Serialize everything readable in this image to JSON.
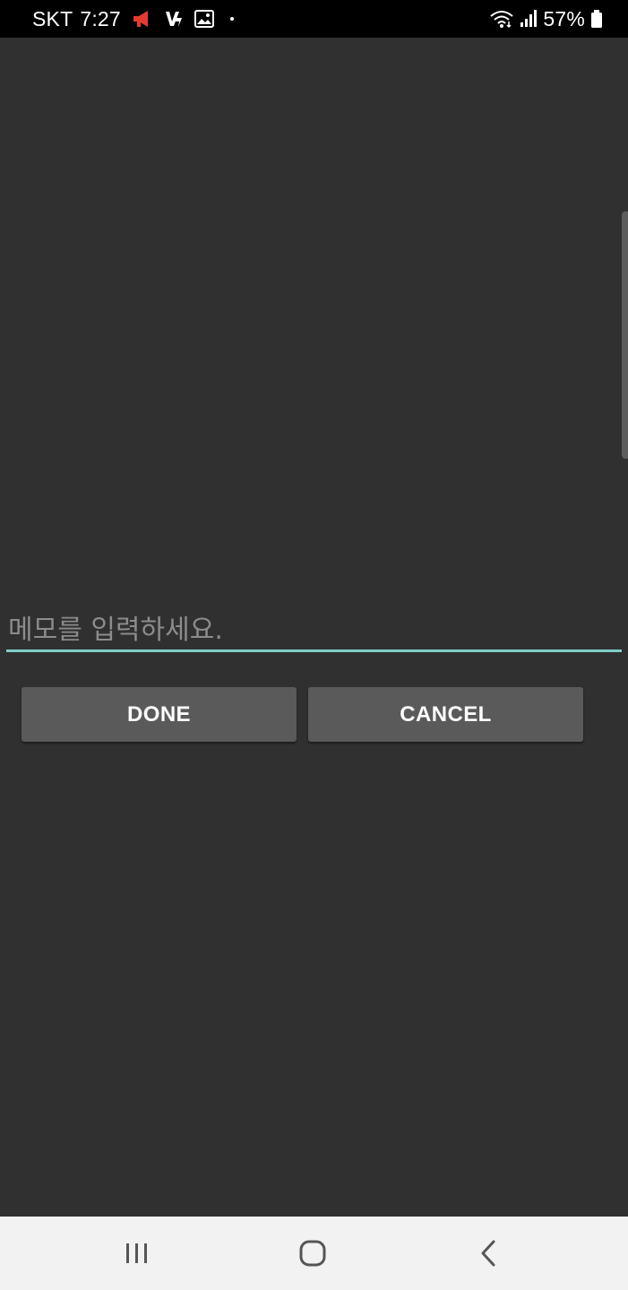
{
  "status_bar": {
    "carrier": "SKT",
    "time": "7:27",
    "battery_percent": "57%",
    "icons_left": [
      "megaphone-icon",
      "lightning-app-icon",
      "image-icon",
      "dot-icon"
    ],
    "icons_right": [
      "wifi-icon",
      "signal-icon",
      "battery-icon"
    ],
    "megaphone_color": "#e53a2f"
  },
  "memo": {
    "placeholder": "메모를 입력하세요.",
    "value": "",
    "underline_color": "#7fcfc6"
  },
  "actions": {
    "done_label": "DONE",
    "cancel_label": "CANCEL"
  },
  "nav_bar": {
    "buttons": [
      "recent-apps-icon",
      "home-icon",
      "back-icon"
    ]
  }
}
